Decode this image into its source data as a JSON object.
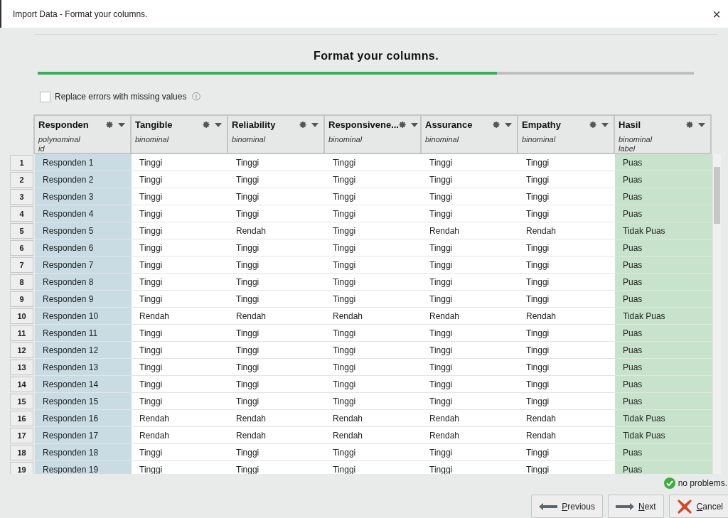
{
  "window": {
    "title": "Import Data - Format your columns.",
    "close": "×"
  },
  "heading": "Format your columns.",
  "progress": {
    "level": 0.7
  },
  "replace_errors": {
    "label": "Replace errors with missing values",
    "checked": false,
    "info": "ⓘ"
  },
  "table": {
    "columns": [
      {
        "name": "Responden",
        "type": "polynominal",
        "role_label": "id",
        "kind": "id"
      },
      {
        "name": "Tangible",
        "type": "binominal",
        "kind": "attribute"
      },
      {
        "name": "Reliability",
        "type": "binominal",
        "kind": "attribute"
      },
      {
        "name": "Responsivene...",
        "type": "binominal",
        "kind": "attribute"
      },
      {
        "name": "Assurance",
        "type": "binominal",
        "kind": "attribute"
      },
      {
        "name": "Empathy",
        "type": "binominal",
        "kind": "attribute"
      },
      {
        "name": "Hasil",
        "type": "binominal",
        "role_label": "label",
        "kind": "label"
      }
    ],
    "rows": [
      {
        "number": "1",
        "cells": [
          "Responden 1",
          "Tinggi",
          "Tinggi",
          "Tinggi",
          "Tinggi",
          "Tinggi",
          "Puas"
        ]
      },
      {
        "number": "2",
        "cells": [
          "Responden 2",
          "Tinggi",
          "Tinggi",
          "Tinggi",
          "Tinggi",
          "Tinggi",
          "Puas"
        ]
      },
      {
        "number": "3",
        "cells": [
          "Responden 3",
          "Tinggi",
          "Tinggi",
          "Tinggi",
          "Tinggi",
          "Tinggi",
          "Puas"
        ]
      },
      {
        "number": "4",
        "cells": [
          "Responden 4",
          "Tinggi",
          "Tinggi",
          "Tinggi",
          "Tinggi",
          "Tinggi",
          "Puas"
        ]
      },
      {
        "number": "5",
        "cells": [
          "Responden 5",
          "Tinggi",
          "Rendah",
          "Tinggi",
          "Rendah",
          "Rendah",
          "Tidak Puas"
        ]
      },
      {
        "number": "6",
        "cells": [
          "Responden 6",
          "Tinggi",
          "Tinggi",
          "Tinggi",
          "Tinggi",
          "Tinggi",
          "Puas"
        ]
      },
      {
        "number": "7",
        "cells": [
          "Responden 7",
          "Tinggi",
          "Tinggi",
          "Tinggi",
          "Tinggi",
          "Tinggi",
          "Puas"
        ]
      },
      {
        "number": "8",
        "cells": [
          "Responden 8",
          "Tinggi",
          "Tinggi",
          "Tinggi",
          "Tinggi",
          "Tinggi",
          "Puas"
        ]
      },
      {
        "number": "9",
        "cells": [
          "Responden 9",
          "Tinggi",
          "Tinggi",
          "Tinggi",
          "Tinggi",
          "Tinggi",
          "Puas"
        ]
      },
      {
        "number": "10",
        "cells": [
          "Responden 10",
          "Rendah",
          "Rendah",
          "Rendah",
          "Rendah",
          "Rendah",
          "Tidak Puas"
        ]
      },
      {
        "number": "11",
        "cells": [
          "Responden 11",
          "Tinggi",
          "Tinggi",
          "Tinggi",
          "Tinggi",
          "Tinggi",
          "Puas"
        ]
      },
      {
        "number": "12",
        "cells": [
          "Responden 12",
          "Tinggi",
          "Tinggi",
          "Tinggi",
          "Tinggi",
          "Tinggi",
          "Puas"
        ]
      },
      {
        "number": "13",
        "cells": [
          "Responden 13",
          "Tinggi",
          "Tinggi",
          "Tinggi",
          "Tinggi",
          "Tinggi",
          "Puas"
        ]
      },
      {
        "number": "14",
        "cells": [
          "Responden 14",
          "Tinggi",
          "Tinggi",
          "Tinggi",
          "Tinggi",
          "Tinggi",
          "Puas"
        ]
      },
      {
        "number": "15",
        "cells": [
          "Responden 15",
          "Tinggi",
          "Tinggi",
          "Tinggi",
          "Tinggi",
          "Tinggi",
          "Puas"
        ]
      },
      {
        "number": "16",
        "cells": [
          "Responden 16",
          "Rendah",
          "Rendah",
          "Rendah",
          "Rendah",
          "Rendah",
          "Tidak Puas"
        ]
      },
      {
        "number": "17",
        "cells": [
          "Responden 17",
          "Rendah",
          "Rendah",
          "Rendah",
          "Rendah",
          "Rendah",
          "Tidak Puas"
        ]
      },
      {
        "number": "18",
        "cells": [
          "Responden 18",
          "Tinggi",
          "Tinggi",
          "Tinggi",
          "Tinggi",
          "Tinggi",
          "Puas"
        ]
      },
      {
        "number": "19",
        "cells": [
          "Responden 19",
          "Tinggi",
          "Tinggi",
          "Tinggi",
          "Tinggi",
          "Tinggi",
          "Puas"
        ]
      }
    ]
  },
  "status": "no problems.",
  "buttons": [
    {
      "label": "Previous",
      "kind": "previous",
      "underline_first": true
    },
    {
      "label": "Next",
      "kind": "next",
      "underline_first": true
    },
    {
      "label": "Cancel",
      "kind": "cancel",
      "underline_first": true
    }
  ]
}
